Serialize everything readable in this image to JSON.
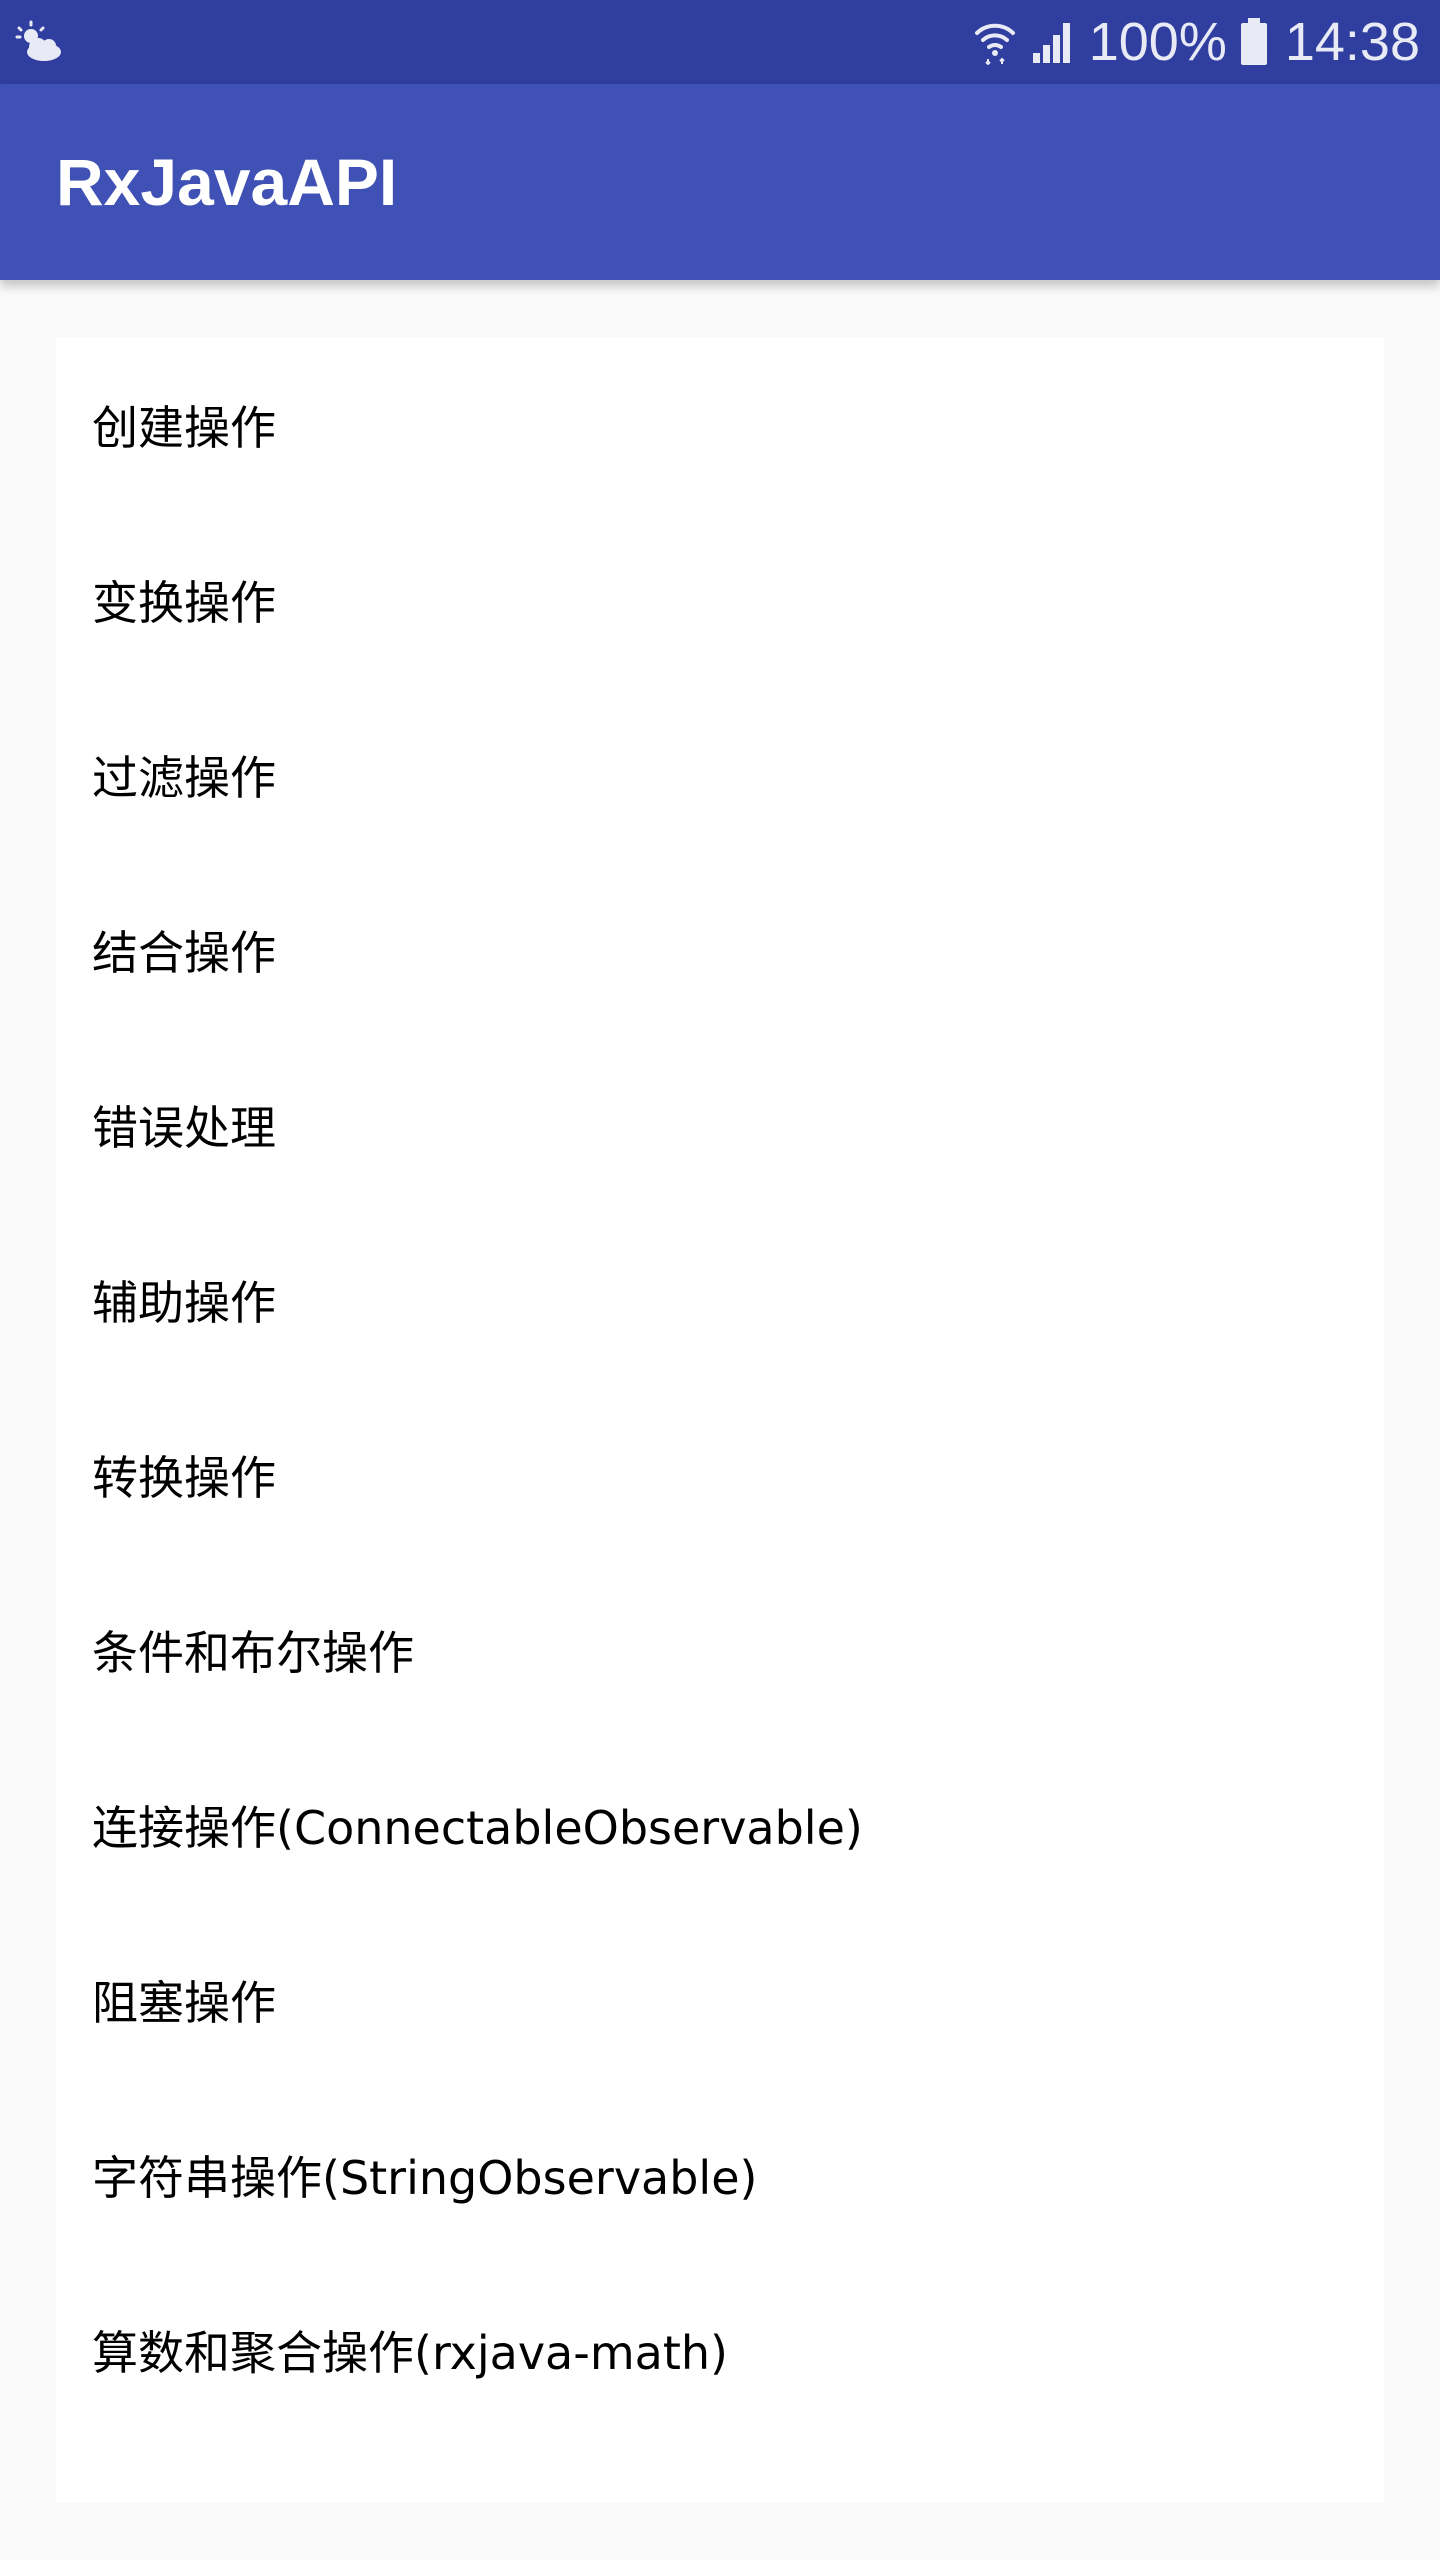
{
  "status_bar": {
    "battery": "100%",
    "time": "14:38",
    "icons": [
      "weather-partly-cloudy-icon",
      "wifi-icon",
      "cell-signal-icon",
      "battery-icon"
    ]
  },
  "app_bar": {
    "title": "RxJavaAPI",
    "color": "#3f51b5",
    "status_color": "#303f9f"
  },
  "list": {
    "items": [
      {
        "label": "创建操作"
      },
      {
        "label": "变换操作"
      },
      {
        "label": "过滤操作"
      },
      {
        "label": "结合操作"
      },
      {
        "label": "错误处理"
      },
      {
        "label": "辅助操作"
      },
      {
        "label": "转换操作"
      },
      {
        "label": "条件和布尔操作"
      },
      {
        "label": "连接操作(ConnectableObservable)"
      },
      {
        "label": "阻塞操作"
      },
      {
        "label": "字符串操作(StringObservable)"
      },
      {
        "label": "算数和聚合操作(rxjava-math)"
      }
    ]
  }
}
